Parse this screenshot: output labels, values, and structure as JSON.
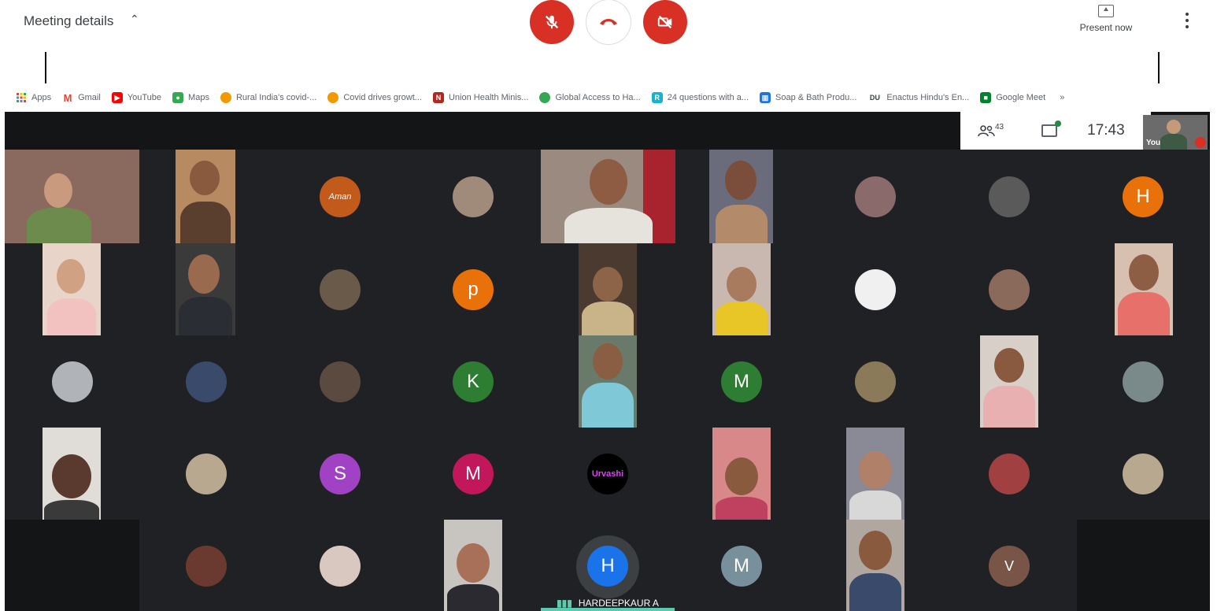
{
  "meeting_bar": {
    "details_label": "Meeting details",
    "present_label": "Present now"
  },
  "bookmarks": [
    {
      "label": "Apps",
      "icon": "apps-grid-icon",
      "color": "#f4b400"
    },
    {
      "label": "Gmail",
      "icon": "gmail-icon",
      "color": "#ea4335"
    },
    {
      "label": "YouTube",
      "icon": "youtube-icon",
      "color": "#ff0000"
    },
    {
      "label": "Maps",
      "icon": "maps-icon",
      "color": "#34a853"
    },
    {
      "label": "Rural India's covid-...",
      "icon": "site-icon",
      "color": "#f29900"
    },
    {
      "label": "Covid drives growt...",
      "icon": "site-icon",
      "color": "#f29900"
    },
    {
      "label": "Union Health Minis...",
      "icon": "site-icon",
      "color": "#b3261e"
    },
    {
      "label": "Global Access to Ha...",
      "icon": "site-icon",
      "color": "#34a853"
    },
    {
      "label": "24 questions with a...",
      "icon": "site-icon",
      "color": "#12b5cb"
    },
    {
      "label": "Soap & Bath Produ...",
      "icon": "site-icon",
      "color": "#1a73e8"
    },
    {
      "label": "Enactus Hindu's En...",
      "icon": "du-icon",
      "color": "#3c4043"
    },
    {
      "label": "Google Meet",
      "icon": "google-meet-icon",
      "color": "#00832d"
    }
  ],
  "bookmarks_more": "»",
  "info_panel": {
    "participant_count": "43",
    "time": "17:43",
    "self_label": "You"
  },
  "avatars": {
    "aman": "Aman",
    "h1": "H",
    "p": "p",
    "k": "K",
    "m1": "M",
    "s": "S",
    "m2": "M",
    "urvashi": "Urvashi",
    "h2": "H",
    "m3": "M",
    "v": "V"
  },
  "speaker": {
    "name": "HARDEEPKAUR A"
  },
  "colors": {
    "end_call": "#d93025",
    "stage_bg": "#202124",
    "speaker_accent": "#5ec8b0"
  }
}
